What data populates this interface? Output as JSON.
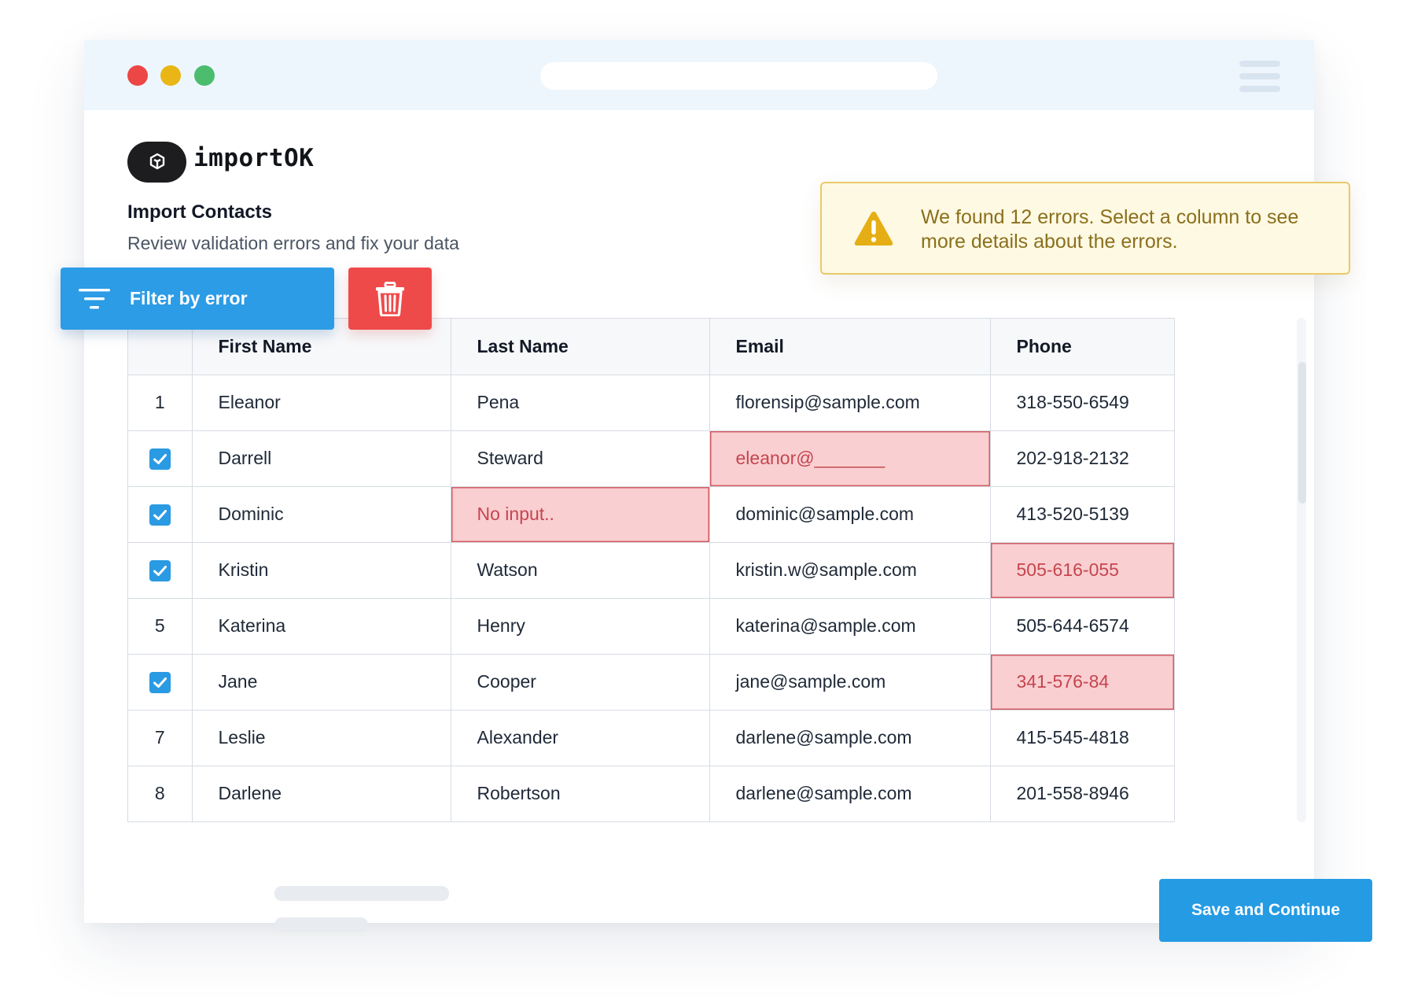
{
  "app": {
    "logo_text": "importOK"
  },
  "page": {
    "title": "Import Contacts",
    "subtitle": "Review validation errors and fix your data"
  },
  "toolbar": {
    "filter_label": "Filter by error",
    "filter_icon": "filter-icon",
    "delete_icon": "trash-icon"
  },
  "alert": {
    "icon": "warning-icon",
    "message": "We found 12 errors. Select a column to see more details about the errors."
  },
  "table": {
    "columns": [
      "First Name",
      "Last Name",
      "Email",
      "Phone"
    ],
    "rows": [
      {
        "marker": "1",
        "checked": false,
        "first": "Eleanor",
        "last": "Pena",
        "email": "florensip@sample.com",
        "phone": "318-550-6549",
        "errors": []
      },
      {
        "marker": "",
        "checked": true,
        "first": "Darrell",
        "last": "Steward",
        "email": "eleanor@_______",
        "phone": "202-918-2132",
        "errors": [
          "email"
        ]
      },
      {
        "marker": "",
        "checked": true,
        "first": "Dominic",
        "last": "No input..",
        "email": "dominic@sample.com",
        "phone": "413-520-5139",
        "errors": [
          "last"
        ]
      },
      {
        "marker": "",
        "checked": true,
        "first": "Kristin",
        "last": "Watson",
        "email": "kristin.w@sample.com",
        "phone": "505-616-055",
        "errors": [
          "phone"
        ]
      },
      {
        "marker": "5",
        "checked": false,
        "first": "Katerina",
        "last": "Henry",
        "email": "katerina@sample.com",
        "phone": "505-644-6574",
        "errors": []
      },
      {
        "marker": "",
        "checked": true,
        "first": "Jane",
        "last": "Cooper",
        "email": "jane@sample.com",
        "phone": "341-576-84",
        "errors": [
          "phone"
        ]
      },
      {
        "marker": "7",
        "checked": false,
        "first": "Leslie",
        "last": "Alexander",
        "email": "darlene@sample.com",
        "phone": "415-545-4818",
        "errors": []
      },
      {
        "marker": "8",
        "checked": false,
        "first": "Darlene",
        "last": "Robertson",
        "email": "darlene@sample.com",
        "phone": "201-558-8946",
        "errors": []
      }
    ]
  },
  "footer": {
    "save_label": "Save and Continue"
  },
  "colors": {
    "accent": "#2c9ce6",
    "danger": "#ef4a4a",
    "error_cell_bg": "#f9cfd1",
    "error_text": "#c5454f",
    "warning_bg": "#fef9e3",
    "warning_text": "#8a6f1c"
  }
}
